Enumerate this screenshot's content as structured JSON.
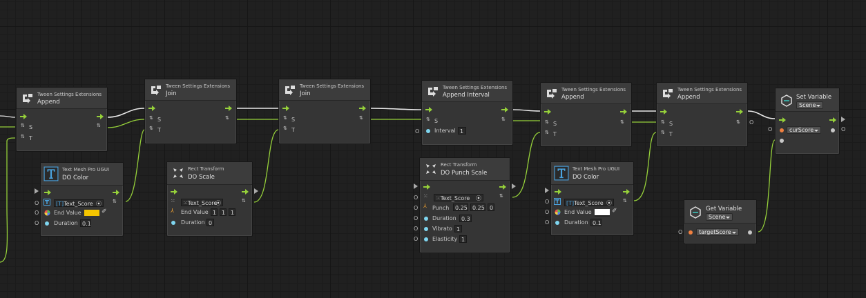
{
  "colors": {
    "flow": "#96d13a",
    "port": "#c8c8c8",
    "wire_flow": "#e8e8e8",
    "wire_data": "#96d13a",
    "set_var_bar": "#3aa7a0",
    "yellow_swatch": "#f5c500",
    "white_swatch": "#ffffff",
    "orange_dot": "#f08040",
    "cyan_dot": "#7fd6f0"
  },
  "nodes": {
    "append1": {
      "subtitle": "Tween Settings Extensions",
      "title": "Append",
      "ports": [
        "S",
        "T"
      ]
    },
    "join1": {
      "subtitle": "Tween Settings Extensions",
      "title": "Join",
      "ports": [
        "S",
        "T"
      ]
    },
    "join2": {
      "subtitle": "Tween Settings Extensions",
      "title": "Join",
      "ports": [
        "S",
        "T"
      ]
    },
    "appendInterval": {
      "subtitle": "Tween Settings Extensions",
      "title": "Append Interval",
      "ports": [
        "S"
      ],
      "interval_label": "Interval",
      "interval_value": "1",
      "ext_o": "O"
    },
    "append2": {
      "subtitle": "Tween Settings Extensions",
      "title": "Append",
      "ports": [
        "S",
        "T"
      ]
    },
    "append3": {
      "subtitle": "Tween Settings Extensions",
      "title": "Append",
      "ports": [
        "S",
        "T"
      ],
      "ext_o": "O"
    },
    "setVar": {
      "title": "Set Variable",
      "scope": "Scene",
      "var": "curScore",
      "ext_o_top": "O",
      "ext_o_mid": "O",
      "ext_o_right": "O"
    },
    "doColor1": {
      "subtitle": "Text Mesh Pro UGUI",
      "title": "DO Color",
      "target": "Text_Score",
      "end_label": "End Value",
      "dur_label": "Duration",
      "dur_value": "0.1",
      "ext_o": [
        "O",
        "O",
        "O"
      ]
    },
    "doScale": {
      "subtitle": "Rect Transform",
      "title": "DO Scale",
      "target": "Text_Score",
      "end_label": "End Value",
      "end_x": "1",
      "end_y": "1",
      "end_z": "1",
      "dur_label": "Duration",
      "dur_value": "0"
    },
    "doPunch": {
      "subtitle": "Rect Transform",
      "title": "DO Punch Scale",
      "target": "Text_Score",
      "punch_label": "Punch",
      "punch_x": "0.25",
      "punch_y": "0.25",
      "punch_z": "0",
      "dur_label": "Duration",
      "dur_value": "0.3",
      "vib_label": "Vibrato",
      "vib_value": "1",
      "el_label": "Elasticity",
      "el_value": "1",
      "ext_o": [
        "O",
        "O",
        "O",
        "O",
        "O"
      ]
    },
    "doColor2": {
      "subtitle": "Text Mesh Pro UGUI",
      "title": "DO Color",
      "target": "Text_Score",
      "end_label": "End Value",
      "dur_label": "Duration",
      "dur_value": "0.1",
      "ext_o": [
        "O",
        "O",
        "O"
      ]
    },
    "getVar": {
      "title": "Get Variable",
      "scope": "Scene",
      "var": "targetScore",
      "ext_o": "O"
    }
  }
}
